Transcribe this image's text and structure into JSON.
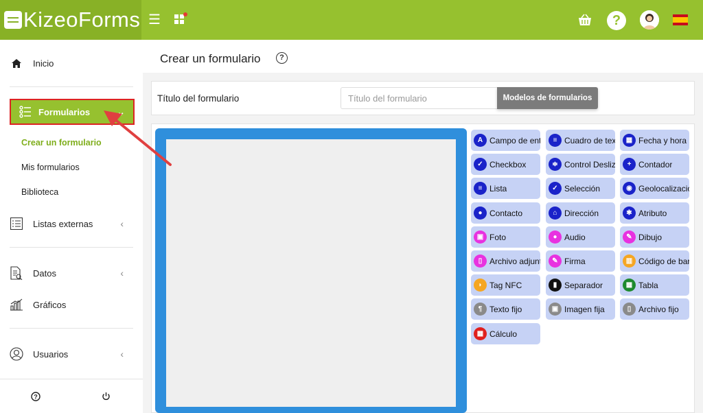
{
  "app": {
    "logo_text": "KizeoForms"
  },
  "topbar": {
    "icons": [
      "menu-icon",
      "apps-icon",
      "basket-icon",
      "help-icon",
      "avatar",
      "spain-flag"
    ],
    "help_glyph": "?"
  },
  "sidebar": {
    "inicio": "Inicio",
    "formularios": "Formularios",
    "sub": {
      "crear": "Crear un formulario",
      "mis": "Mis formularios",
      "biblioteca": "Biblioteca"
    },
    "listas": "Listas externas",
    "datos": "Datos",
    "graficos": "Gráficos",
    "usuarios": "Usuarios"
  },
  "main": {
    "title": "Crear un formulario",
    "title_label": "Título del formulario",
    "title_placeholder": "Título del formulario",
    "models_button": "Modelos de formularios"
  },
  "fields": [
    {
      "label": "Campo de entrada",
      "icon": "A",
      "color": "#1a23c9"
    },
    {
      "label": "Cuadro de texto",
      "icon": "≡",
      "color": "#1a23c9"
    },
    {
      "label": "Fecha y hora",
      "icon": "▦",
      "color": "#1a23c9"
    },
    {
      "label": "Checkbox",
      "icon": "✓",
      "color": "#1a23c9"
    },
    {
      "label": "Control Deslizante",
      "icon": "≑",
      "color": "#1a23c9"
    },
    {
      "label": "Contador",
      "icon": "+",
      "color": "#1a23c9"
    },
    {
      "label": "Lista",
      "icon": "≡",
      "color": "#1a23c9"
    },
    {
      "label": "Selección",
      "icon": "✓",
      "color": "#1a23c9"
    },
    {
      "label": "Geolocalización",
      "icon": "◉",
      "color": "#1a23c9"
    },
    {
      "label": "Contacto",
      "icon": "●",
      "color": "#1a23c9"
    },
    {
      "label": "Dirección",
      "icon": "⌂",
      "color": "#1a23c9"
    },
    {
      "label": "Atributo",
      "icon": "✱",
      "color": "#1a23c9"
    },
    {
      "label": "Foto",
      "icon": "▣",
      "color": "#e832e0"
    },
    {
      "label": "Audio",
      "icon": "●",
      "color": "#e832e0"
    },
    {
      "label": "Dibujo",
      "icon": "✎",
      "color": "#e832e0"
    },
    {
      "label": "Archivo adjunto",
      "icon": "▯",
      "color": "#e832e0"
    },
    {
      "label": "Firma",
      "icon": "✎",
      "color": "#e832e0"
    },
    {
      "label": "Código de barras",
      "icon": "▥",
      "color": "#f5a623"
    },
    {
      "label": "Tag NFC",
      "icon": "◗",
      "color": "#f5a623"
    },
    {
      "label": "Separador",
      "icon": "▮",
      "color": "#111111"
    },
    {
      "label": "Tabla",
      "icon": "▦",
      "color": "#1e8a2e"
    },
    {
      "label": "Texto fijo",
      "icon": "¶",
      "color": "#8a8a8a"
    },
    {
      "label": "Imagen fija",
      "icon": "▣",
      "color": "#8a8a8a"
    },
    {
      "label": "Archivo fijo",
      "icon": "▯",
      "color": "#8a8a8a"
    },
    {
      "label": "Cálculo",
      "icon": "▦",
      "color": "#e0201e"
    }
  ],
  "colors": {
    "brand_green": "#96c12f",
    "canvas_blue": "#2f8fdc",
    "field_bg": "#c6d2f5",
    "highlight_red": "#d22222"
  }
}
